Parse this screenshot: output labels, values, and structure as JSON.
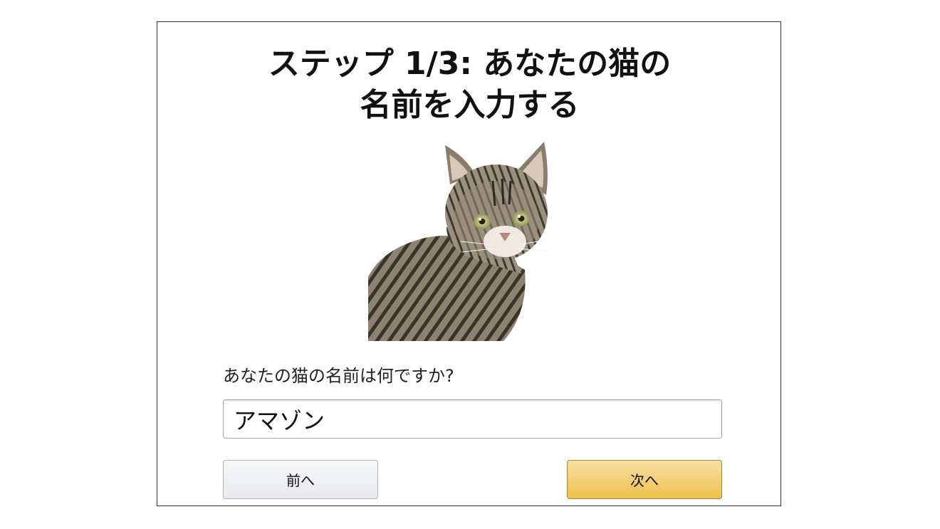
{
  "title": {
    "line1": "ステップ 1/3: あなたの猫の",
    "line2": "名前を入力する"
  },
  "question": "あなたの猫の名前は何ですか?",
  "name_input": {
    "value": "アマゾン"
  },
  "buttons": {
    "prev_label": "前へ",
    "next_label": "次へ"
  },
  "colors": {
    "next_button": "#f0c14b",
    "prev_button": "#e7e9ec",
    "frame_border": "#333333"
  }
}
